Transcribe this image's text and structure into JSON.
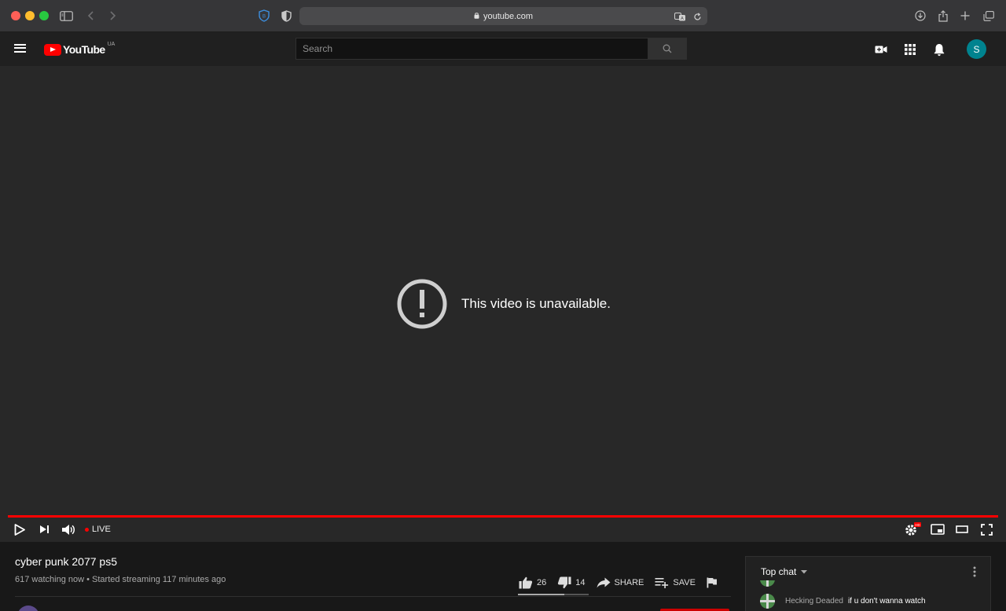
{
  "browser": {
    "url": "youtube.com"
  },
  "header": {
    "logo_text": "YouTube",
    "country_code": "UA",
    "search_placeholder": "Search",
    "avatar_letter": "S"
  },
  "player": {
    "error_message": "This video is unavailable.",
    "live_label": "LIVE",
    "progress": 1.0,
    "quality_badge": "HD"
  },
  "video": {
    "title": "cyber punk 2077 ps5",
    "meta": "617 watching now • Started streaming 117 minutes ago",
    "likes": "26",
    "dislikes": "14",
    "share_label": "SHARE",
    "save_label": "SAVE",
    "like_ratio": 0.65
  },
  "chat": {
    "title": "Top chat",
    "messages": [
      {
        "author": "Hecking Deaded",
        "text": "if u don't wanna watch"
      }
    ]
  },
  "colors": {
    "accent": "#ff0000",
    "avatar": "#00838f",
    "player_bg": "#282828"
  }
}
